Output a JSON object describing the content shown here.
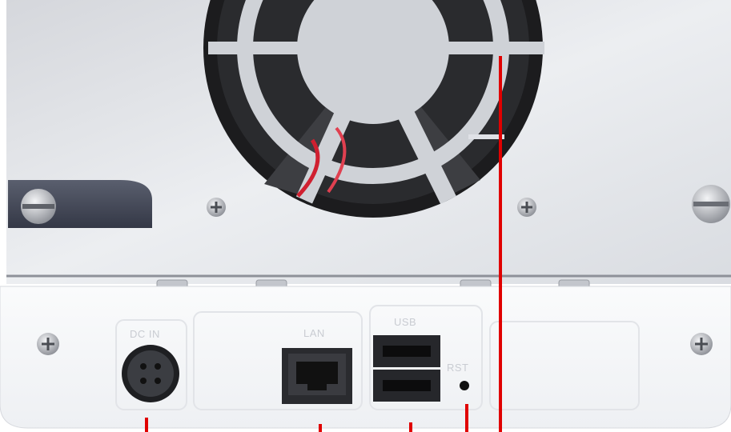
{
  "device": {
    "panel_color": "#dfe1e6",
    "base_color": "#f4f5f7",
    "fan_color": "#1c1c1e",
    "callout_color": "#e00000"
  },
  "ports": {
    "dc_in_label": "DC IN",
    "lan_label": "LAN",
    "usb_label": "USB",
    "reset_label": "RST"
  },
  "icons": [
    "screw-icon",
    "fan-grille-icon",
    "power-jack-icon",
    "ethernet-port-icon",
    "usb-port-icon"
  ]
}
